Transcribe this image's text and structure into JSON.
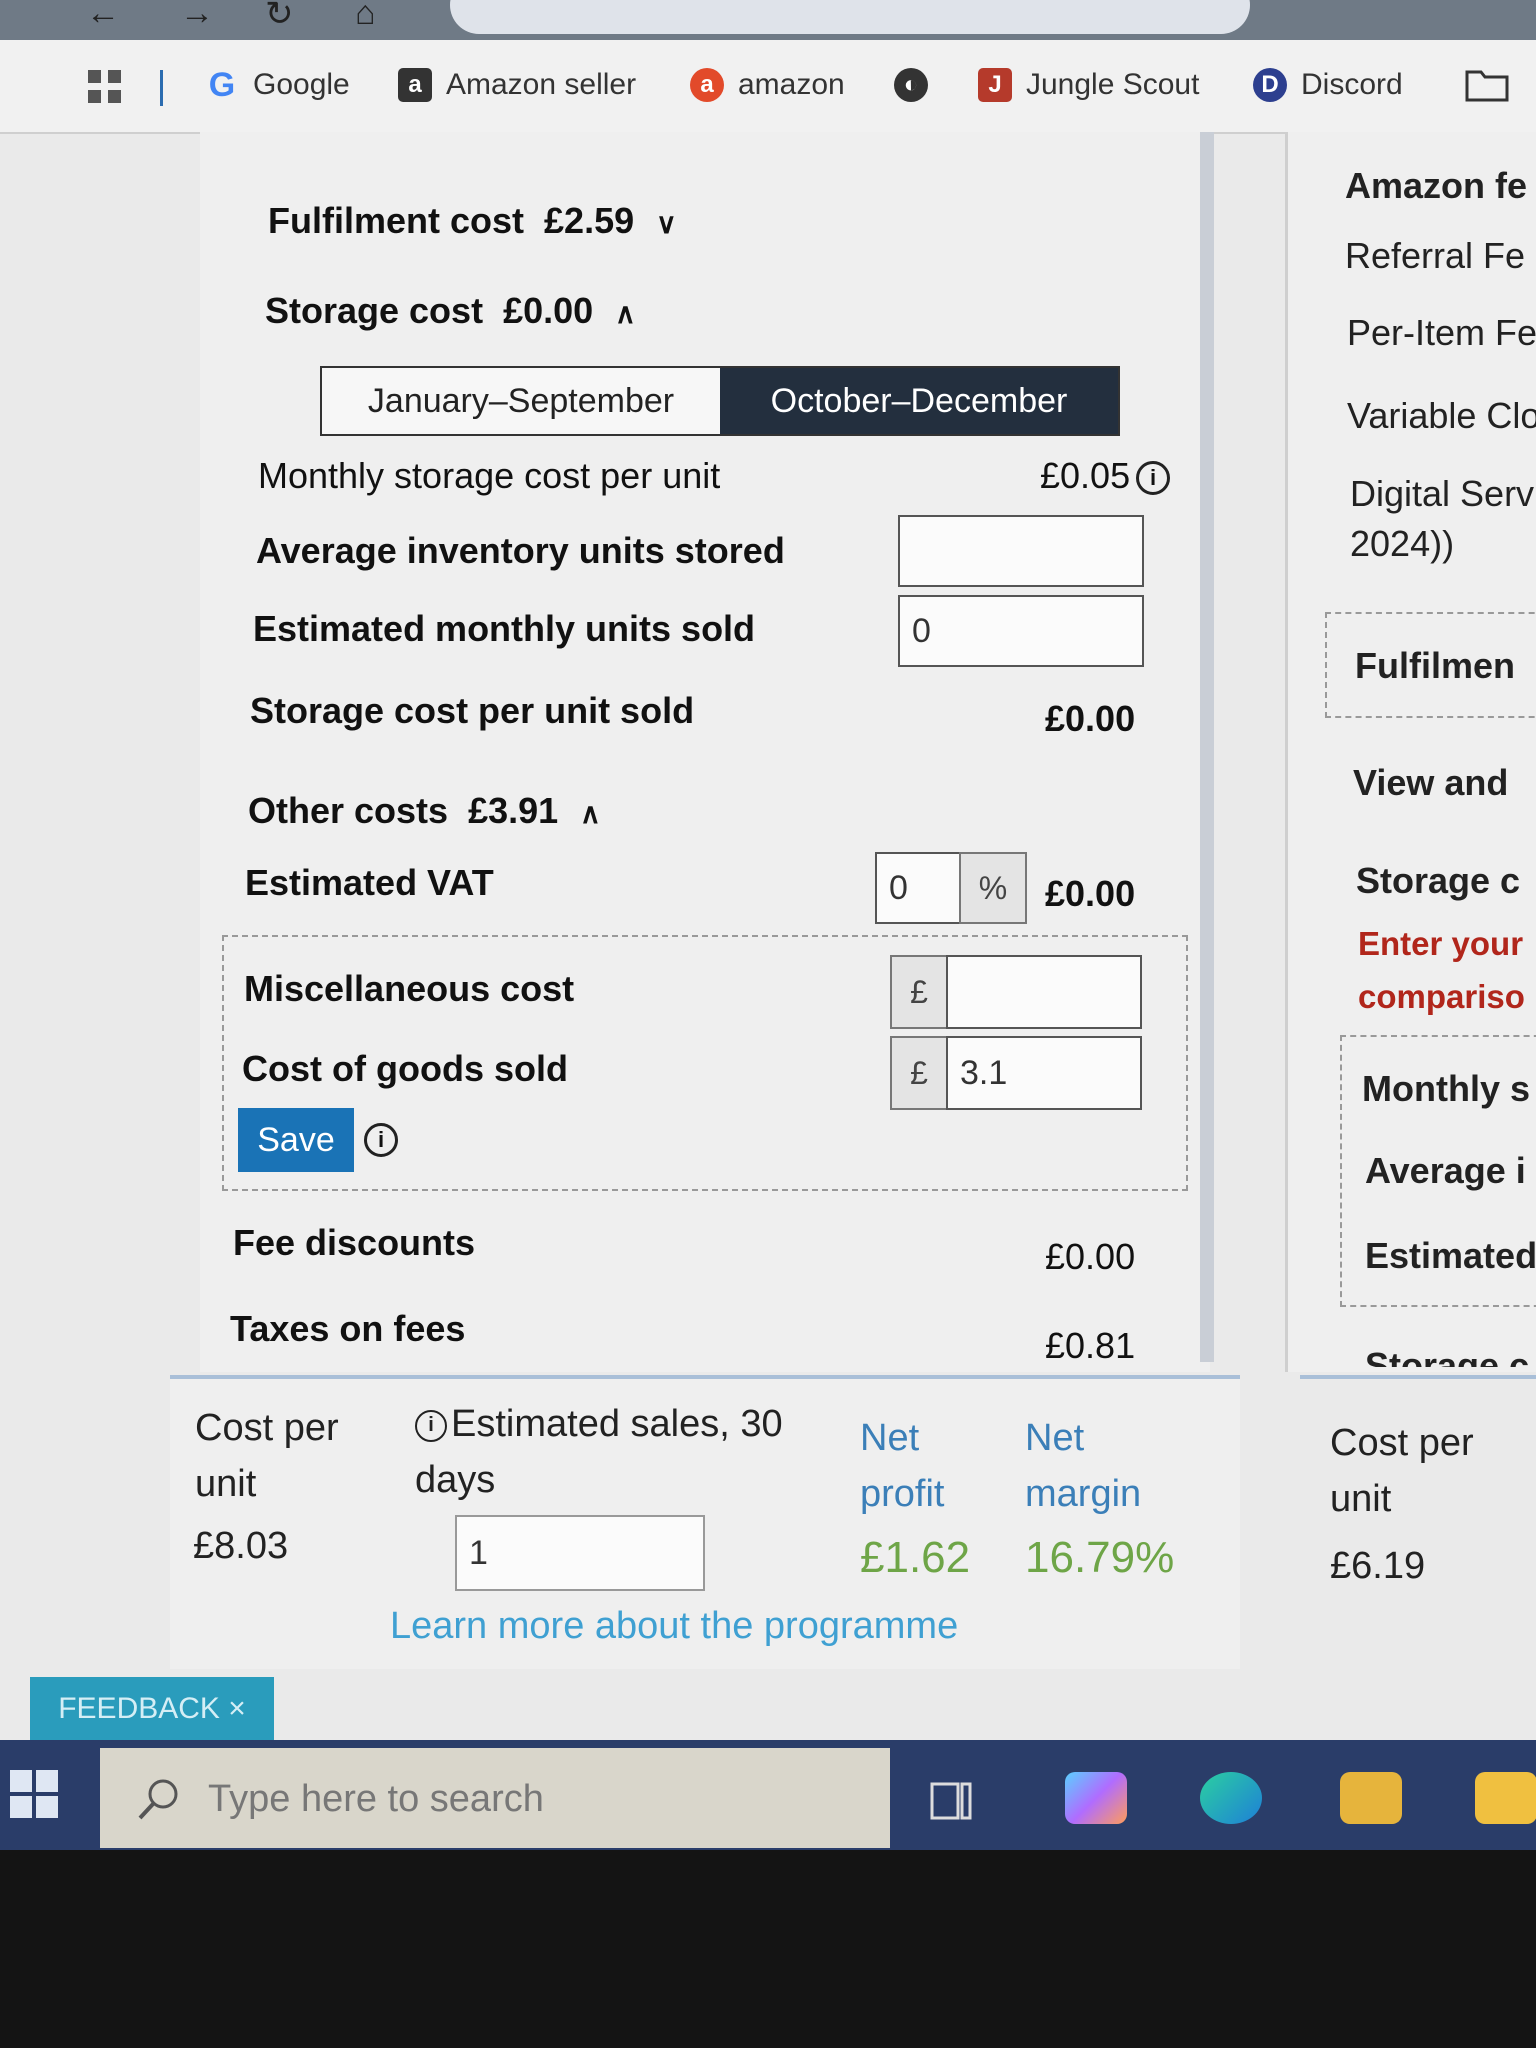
{
  "bookmarks": [
    {
      "label": "Google",
      "icon": "google-icon"
    },
    {
      "label": "Amazon seller",
      "icon": "amazon-seller-icon"
    },
    {
      "label": "amazon",
      "icon": "amazon-icon"
    },
    {
      "label": "",
      "icon": "globe-icon"
    },
    {
      "label": "Jungle Scout",
      "icon": "jungle-scout-icon"
    },
    {
      "label": "Discord",
      "icon": "discord-icon"
    }
  ],
  "calculator": {
    "fulfilment": {
      "label": "Fulfilment cost",
      "value": "£2.59"
    },
    "storage": {
      "label": "Storage cost",
      "value": "£0.00"
    },
    "periods": [
      "January–September",
      "October–December"
    ],
    "selected_period": "October–December",
    "monthly_storage": {
      "label": "Monthly storage cost per unit",
      "value": "£0.05"
    },
    "avg_inventory": {
      "label": "Average inventory units stored",
      "value": ""
    },
    "est_monthly_sold": {
      "label": "Estimated monthly units sold",
      "value": "0"
    },
    "storage_per_unit": {
      "label": "Storage cost per unit sold",
      "value": "£0.00"
    },
    "other": {
      "label": "Other costs",
      "value": "£3.91"
    },
    "vat": {
      "label": "Estimated VAT",
      "percent": "0",
      "percent_sign": "%",
      "value": "£0.00"
    },
    "misc": {
      "label": "Miscellaneous cost",
      "currency": "£",
      "value": ""
    },
    "cogs": {
      "label": "Cost of goods sold",
      "currency": "£",
      "value": "3.1"
    },
    "save_label": "Save",
    "fee_discounts": {
      "label": "Fee discounts",
      "value": "£0.00"
    },
    "taxes_on_fees": {
      "label": "Taxes on fees",
      "value": "£0.81"
    }
  },
  "summary": {
    "cost_per_unit_label": "Cost per unit",
    "cost_per_unit": "£8.03",
    "est_sales_label": "Estimated sales, 30 days",
    "est_sales_value": "1",
    "net_profit_label": "Net profit",
    "net_profit": "£1.62",
    "net_margin_label": "Net margin",
    "net_margin": "16.79%",
    "learn_more": "Learn more about the programme"
  },
  "right_panel": {
    "heading": "Amazon fe",
    "referral": "Referral Fe",
    "per_item": "Per-Item Fe",
    "variable": "Variable Clo",
    "digital_line1": "Digital Serv",
    "digital_line2": "2024))",
    "fulfilment": "Fulfilmen",
    "view_and": "View and",
    "storage": "Storage c",
    "enter_your": "Enter your",
    "comparison": "compariso",
    "monthly": "Monthly s",
    "average": "Average i",
    "estimated": "Estimated",
    "storage_cut": "Storage c",
    "cost_per_unit_label": "Cost per unit",
    "cost_per_unit": "£6.19"
  },
  "feedback_label": "FEEDBACK ×",
  "taskbar": {
    "search_placeholder": "Type here to search"
  }
}
